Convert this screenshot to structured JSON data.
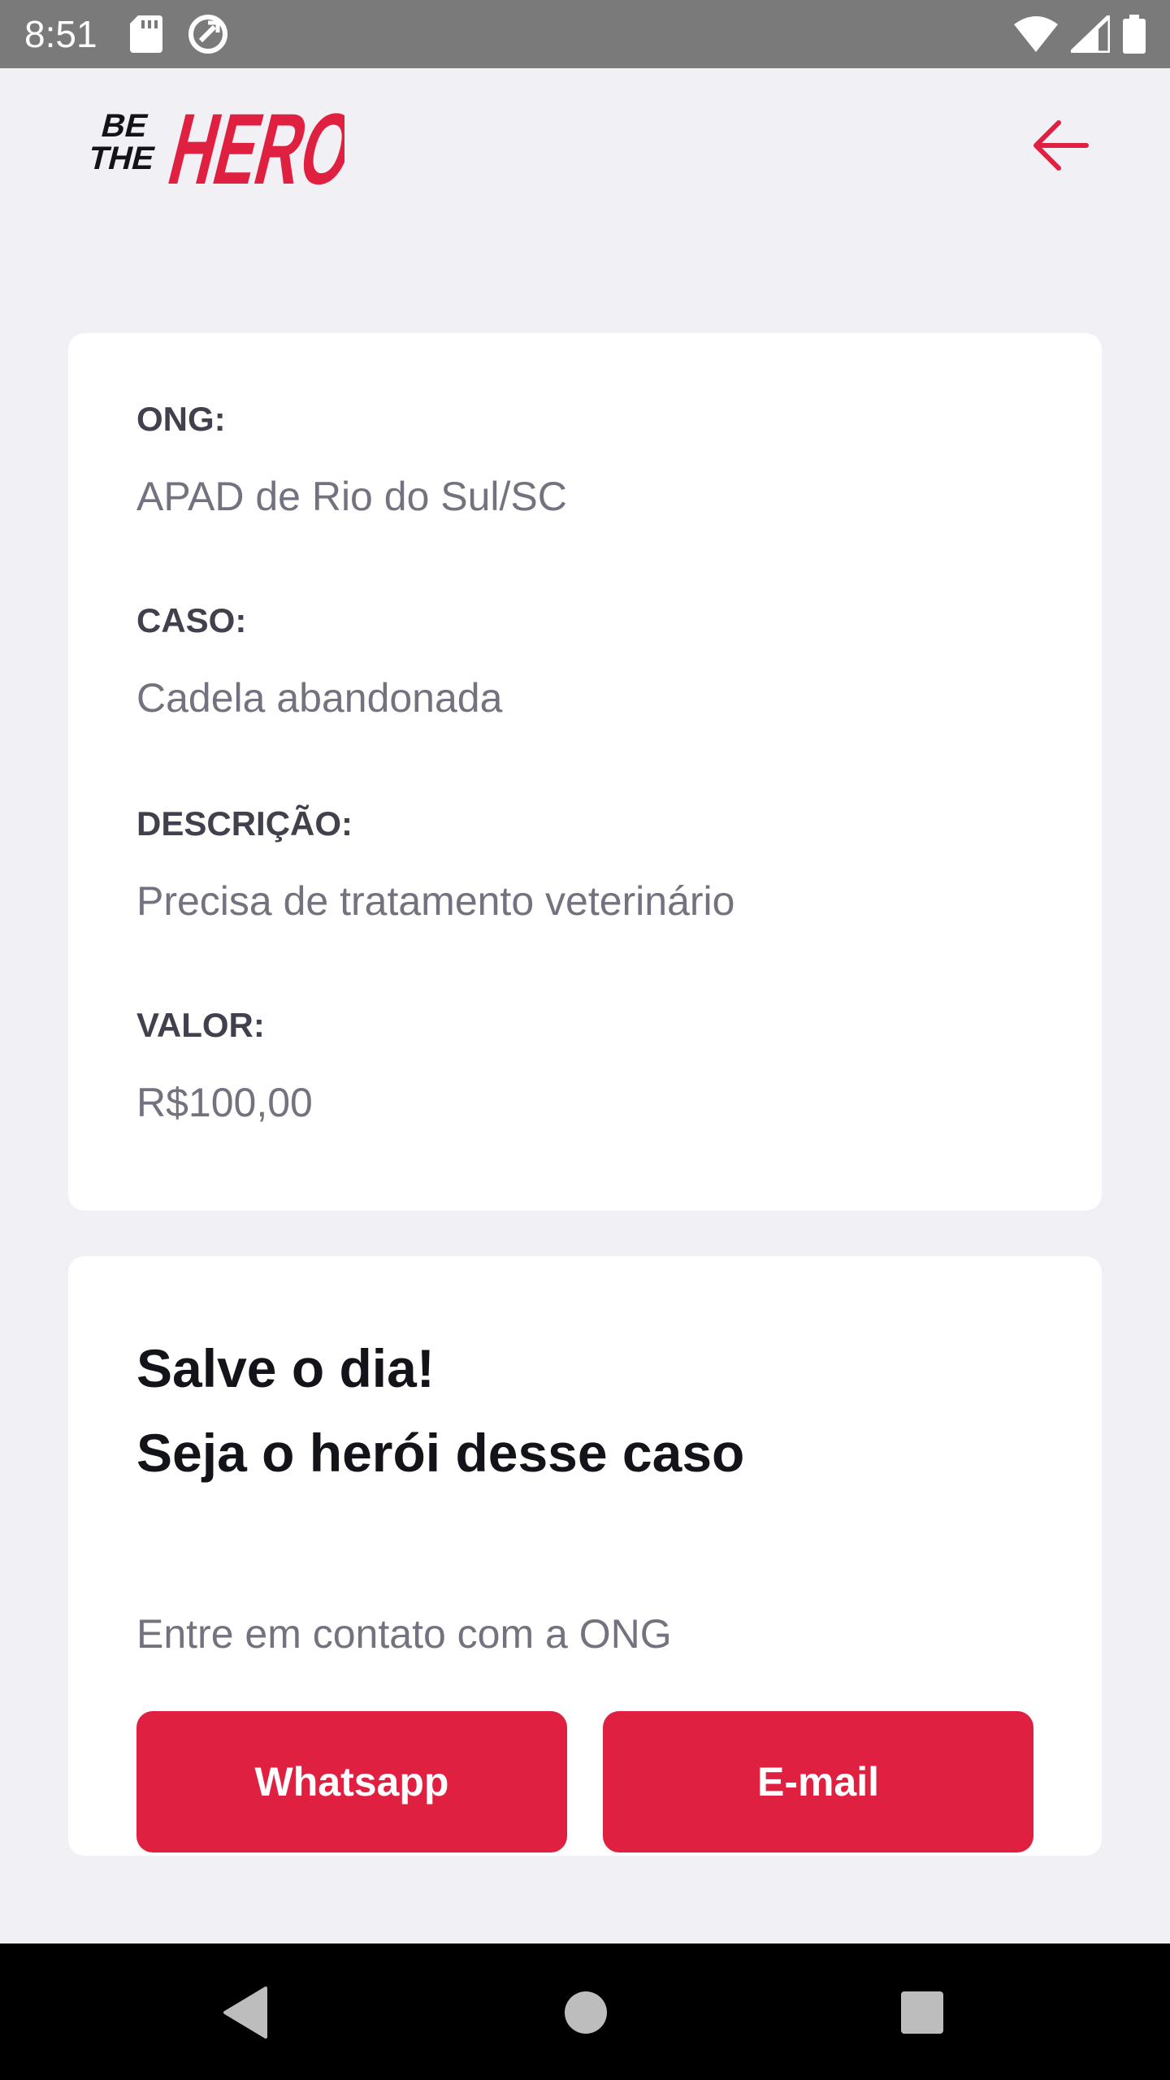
{
  "status_bar": {
    "time": "8:51",
    "icons": [
      "sd-card-icon",
      "sync-icon",
      "wifi-icon",
      "signal-icon",
      "battery-icon"
    ]
  },
  "header": {
    "logo": {
      "line1": "BE",
      "line2": "THE",
      "line3": "HERO"
    },
    "back_icon": "arrow-left-icon"
  },
  "incident": {
    "ong_label": "ONG:",
    "ong_value": "APAD de Rio do Sul/SC",
    "caso_label": "CASO:",
    "caso_value": "Cadela abandonada",
    "descricao_label": "DESCRIÇÃO:",
    "descricao_value": "Precisa de tratamento veterinário",
    "valor_label": "VALOR:",
    "valor_value": "R$100,00"
  },
  "contact": {
    "title_line1": "Salve o dia!",
    "title_line2": "Seja o herói desse caso",
    "description": "Entre em contato com a ONG",
    "whatsapp_label": "Whatsapp",
    "email_label": "E-mail"
  },
  "colors": {
    "accent": "#e02041",
    "background": "#f0f0f5",
    "label": "#41414d",
    "value": "#737380",
    "title": "#13131a"
  }
}
